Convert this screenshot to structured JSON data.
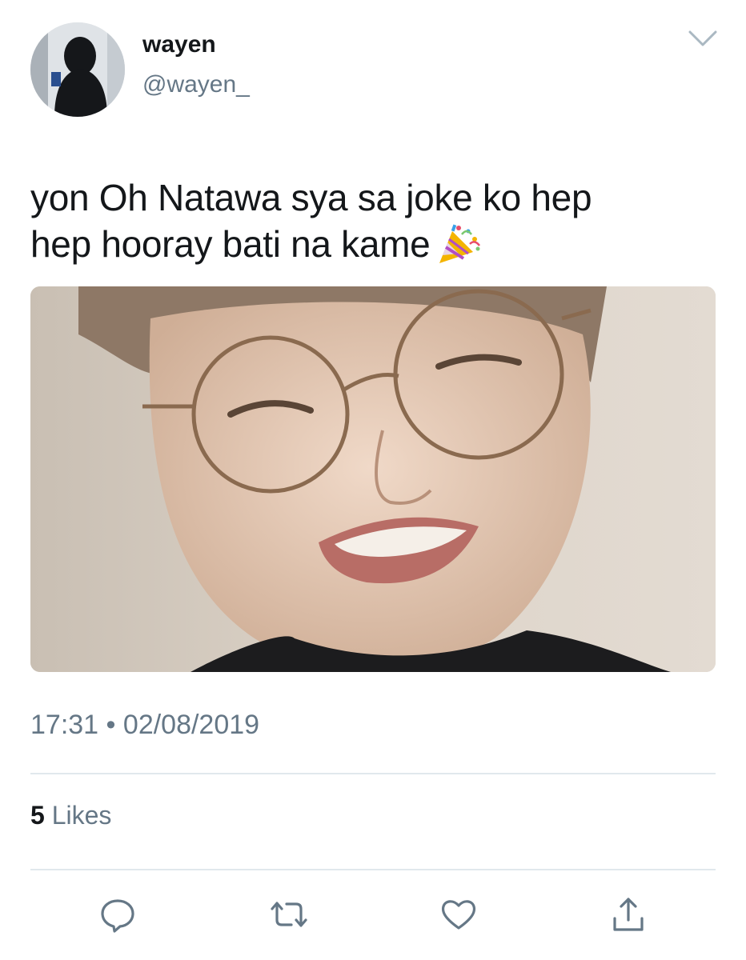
{
  "author": {
    "display_name": "wayen",
    "handle": "@wayen_"
  },
  "tweet": {
    "text_line1": "yon Oh Natawa sya sa joke ko hep",
    "text_line2": "hep hooray bati na kame",
    "emoji_icon": "party-popper-icon",
    "media_alt_icon": "photo"
  },
  "meta": {
    "time": "17:31",
    "separator": "•",
    "date": "02/08/2019"
  },
  "stats": {
    "likes_count": "5",
    "likes_label": "Likes"
  },
  "actions": [
    {
      "name": "reply",
      "icon": "reply-icon"
    },
    {
      "name": "retweet",
      "icon": "retweet-icon"
    },
    {
      "name": "like",
      "icon": "heart-icon"
    },
    {
      "name": "share",
      "icon": "share-icon"
    }
  ],
  "colors": {
    "text_primary": "#14171a",
    "text_secondary": "#657786",
    "divider": "#e1e8ed",
    "icon": "#657786"
  }
}
